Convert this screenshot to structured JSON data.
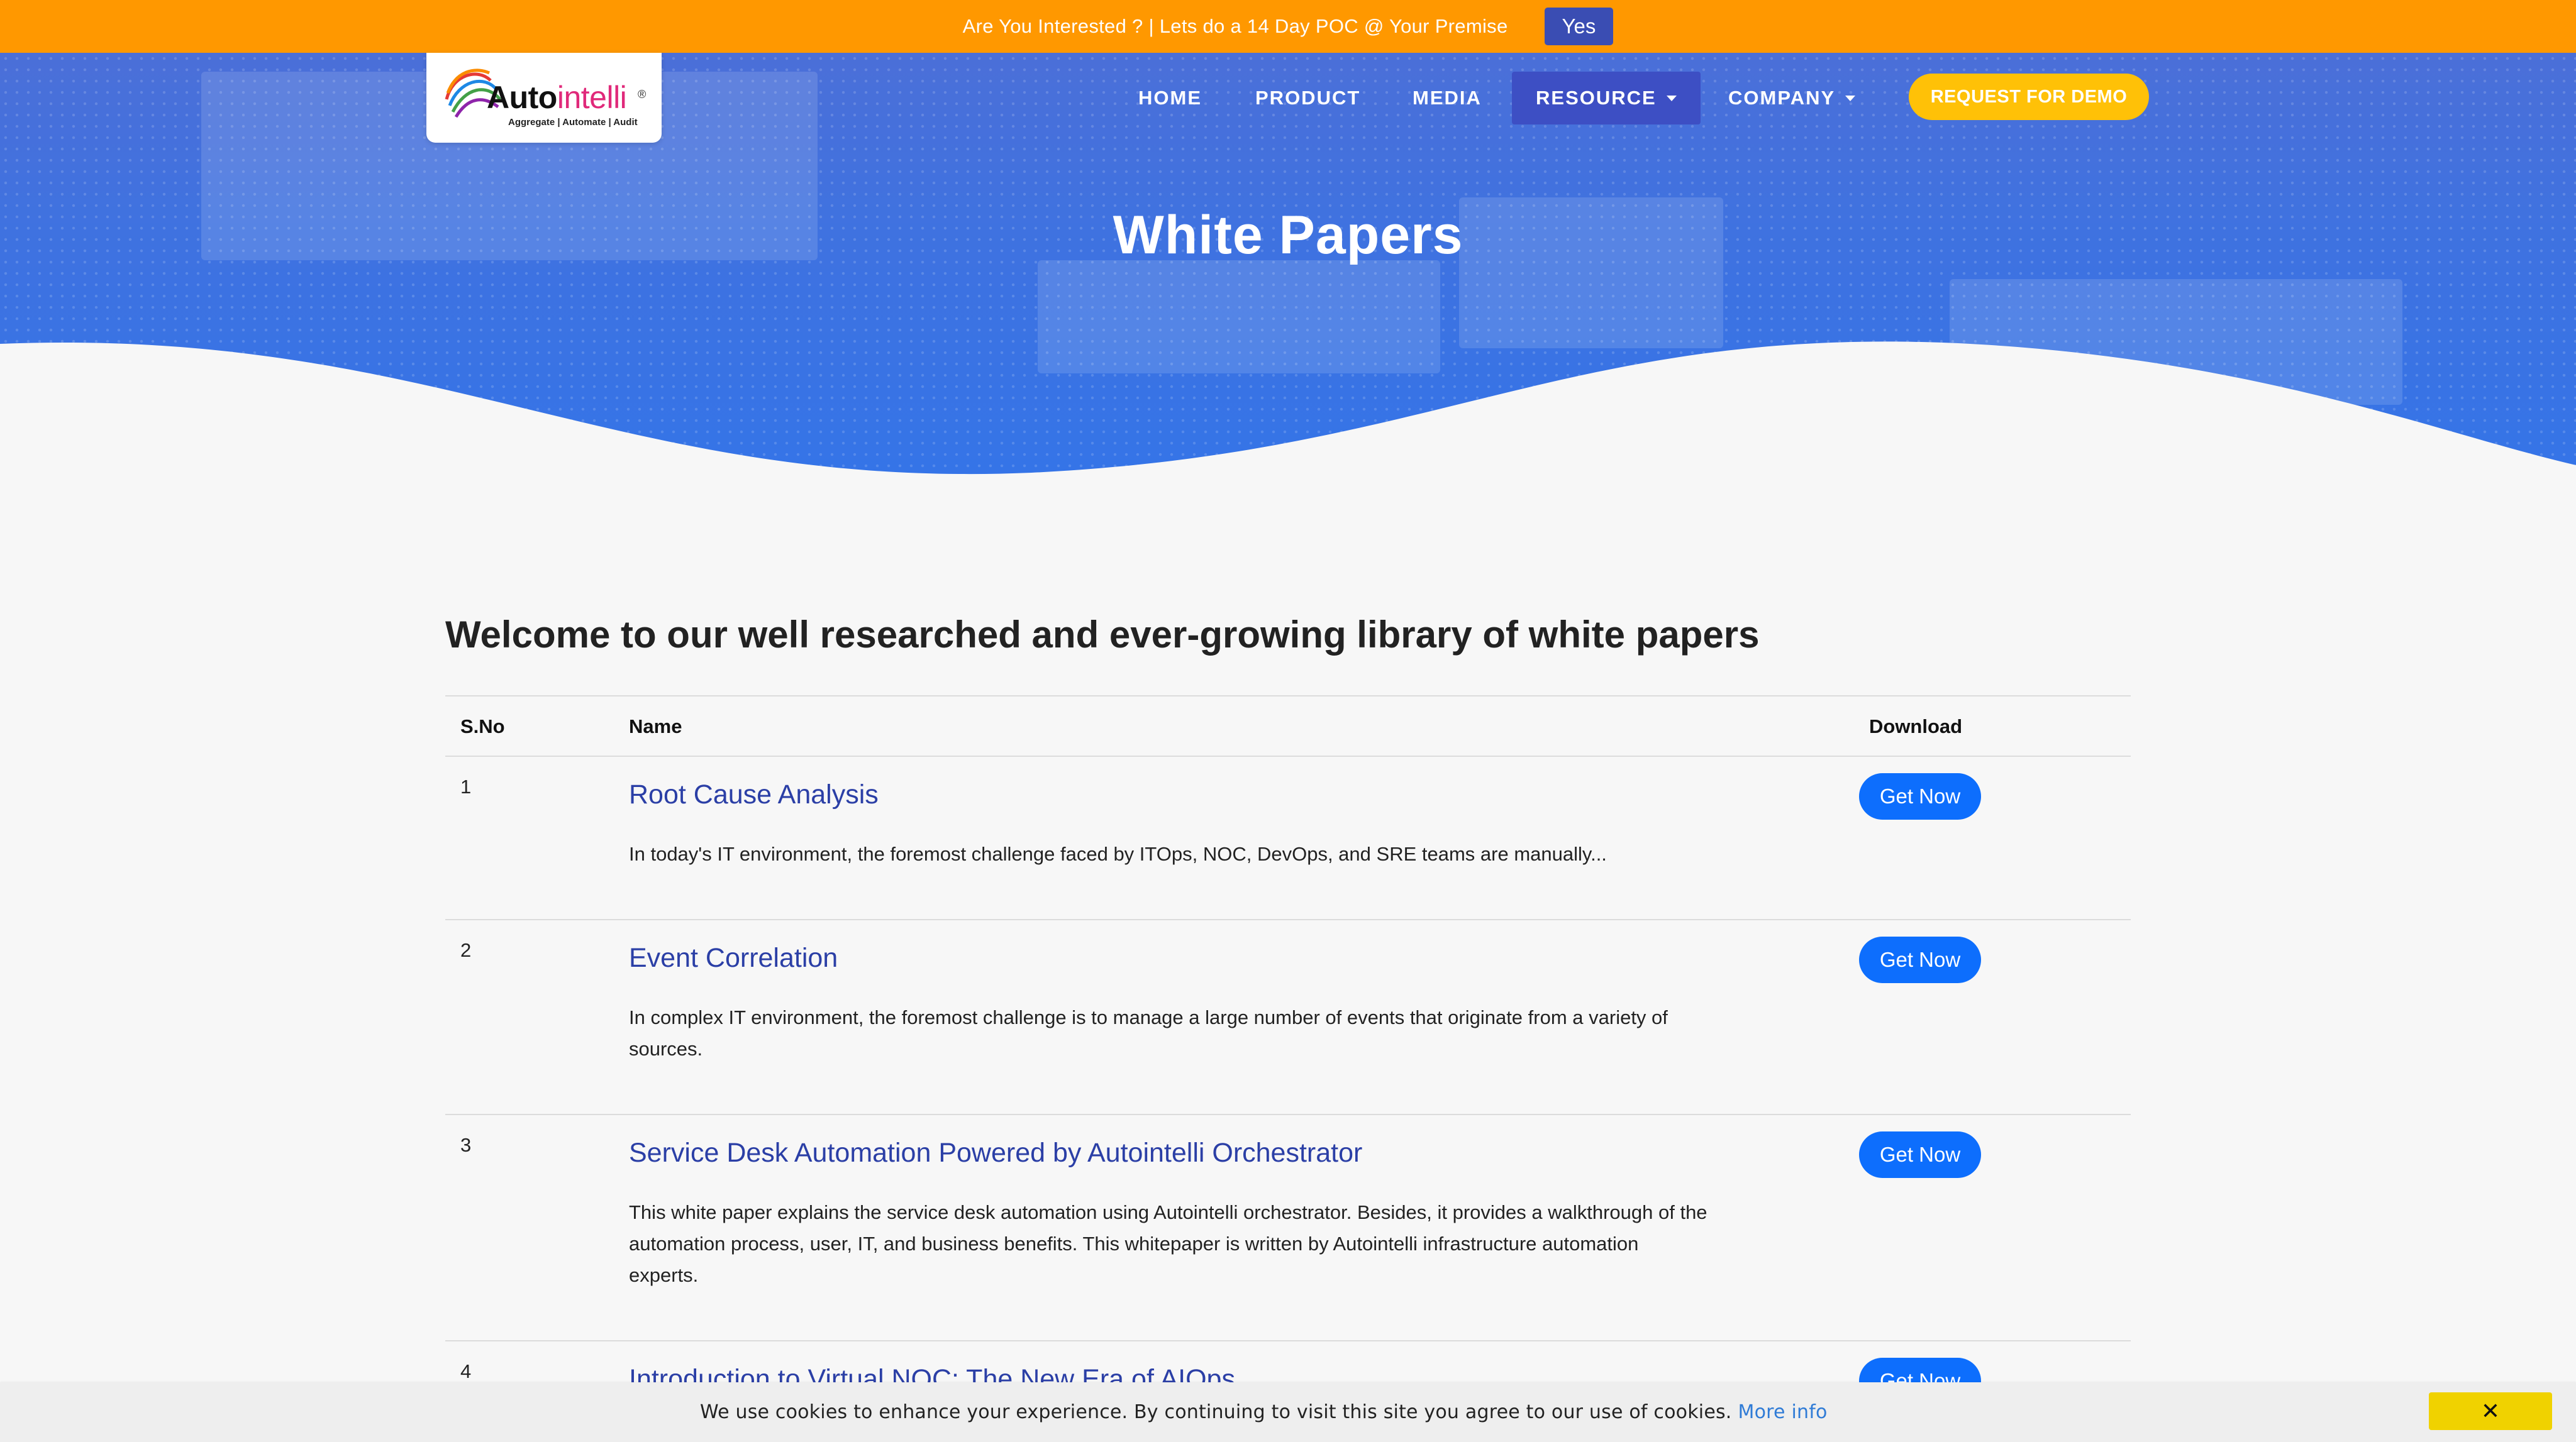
{
  "promo": {
    "text": "Are You Interested ? | Lets do a 14 Day POC @ Your Premise",
    "yes_label": "Yes"
  },
  "logo": {
    "word_dark": "Auto",
    "word_light": "intelli",
    "registered": "®",
    "tagline": "Aggregate | Automate | Audit"
  },
  "nav": {
    "items": [
      {
        "label": "HOME"
      },
      {
        "label": "PRODUCT"
      },
      {
        "label": "MEDIA"
      },
      {
        "label": "RESOURCE",
        "dropdown": true,
        "active": true
      },
      {
        "label": "COMPANY",
        "dropdown": true
      }
    ],
    "demo_label": "REQUEST FOR DEMO"
  },
  "hero": {
    "title": "White Papers"
  },
  "intro": "Welcome to our well researched and ever-growing library of white papers",
  "table": {
    "headers": {
      "sno": "S.No",
      "name": "Name",
      "download": "Download"
    },
    "rows": [
      {
        "sno": "1",
        "title": "Root Cause Analysis",
        "description": "In today's IT environment, the foremost challenge faced by ITOps, NOC, DevOps, and SRE teams are manually...",
        "button": "Get Now"
      },
      {
        "sno": "2",
        "title": "Event Correlation",
        "description": "In complex IT environment, the foremost challenge is to manage a large number of events that originate from a variety of sources.",
        "button": "Get Now"
      },
      {
        "sno": "3",
        "title": "Service Desk Automation Powered by Autointelli Orchestrator",
        "description": "This white paper explains the service desk automation using Autointelli orchestrator. Besides, it provides a walkthrough of the automation process, user, IT, and business benefits. This whitepaper is written by Autointelli infrastructure automation experts.",
        "button": "Get Now"
      },
      {
        "sno": "4",
        "title": "Introduction to Virtual NOC: The New Era of AIOps",
        "description": "",
        "button": "Get Now"
      }
    ]
  },
  "cookie": {
    "message": "We use cookies to enhance your experience. By continuing to visit this site you agree to our use of cookies.",
    "more_label": "More info",
    "close_label": "✕"
  },
  "colors": {
    "promo_bg": "#ff9800",
    "hero_blue": "#3474e8",
    "nav_active": "#3d4fc4",
    "demo_yellow": "#ffc107",
    "button_blue": "#0d6efd",
    "title_link": "#2b3fa6"
  }
}
